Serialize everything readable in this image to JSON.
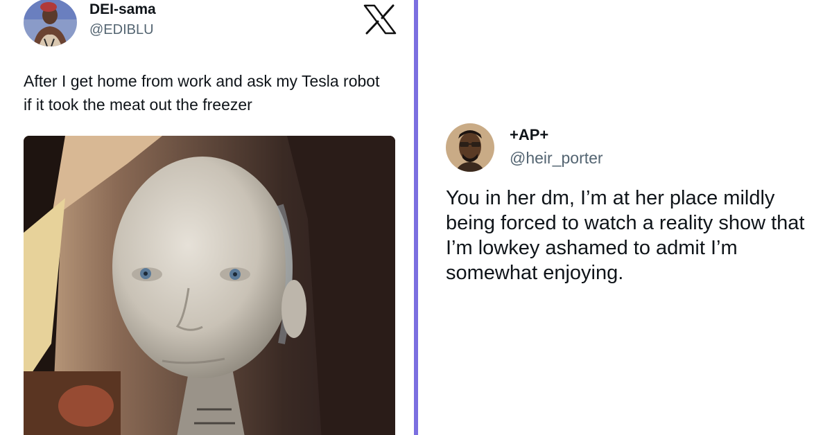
{
  "left_tweet": {
    "author_name": "DEI-sama",
    "author_handle": "@EDIBLU",
    "text": "After I get home from work and ask my Tesla robot if it took the meat out the freezer",
    "platform_icon": "x-logo-icon",
    "media": "robot-face-image"
  },
  "right_tweet": {
    "author_name": "+AP+",
    "author_handle": "@heir_porter",
    "text": "You in her dm, I’m at her place mildly being forced to watch a reality show that I’m lowkey ashamed to admit I’m somewhat enjoying."
  },
  "colors": {
    "divider": "#7b6fe0",
    "text_primary": "#0f1419",
    "text_secondary": "#536471",
    "background": "#ffffff"
  }
}
